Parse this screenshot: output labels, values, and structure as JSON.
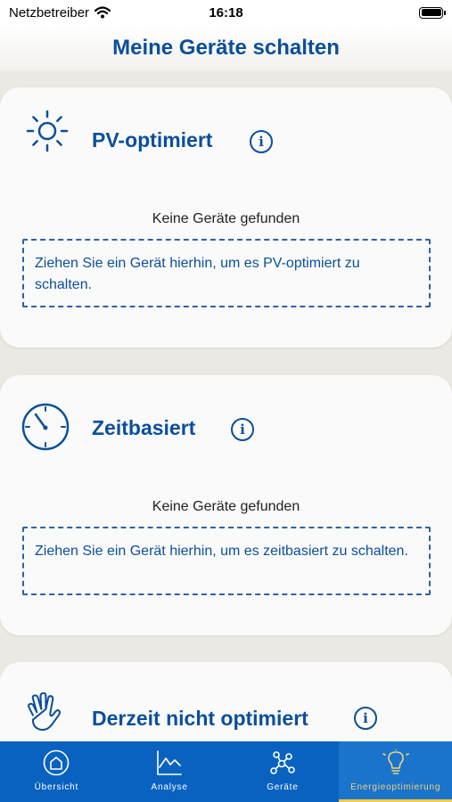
{
  "status_bar": {
    "carrier": "Netzbetreiber",
    "time": "16:18"
  },
  "header": {
    "title": "Meine Geräte schalten"
  },
  "cards": [
    {
      "title": "PV-optimiert",
      "icon": "sun-icon",
      "empty_text": "Keine Geräte gefunden",
      "drop_hint": "Ziehen Sie ein Gerät hierhin, um es PV-optimiert zu schalten."
    },
    {
      "title": "Zeitbasiert",
      "icon": "clock-icon",
      "empty_text": "Keine Geräte gefunden",
      "drop_hint": "Ziehen Sie ein Gerät hierhin, um es zeitbasiert zu schalten."
    },
    {
      "title": "Derzeit nicht optimiert",
      "icon": "hand-icon"
    }
  ],
  "info_glyph": "i",
  "tabs": [
    {
      "label": "Übersicht",
      "icon": "home-icon",
      "active": false
    },
    {
      "label": "Analyse",
      "icon": "chart-icon",
      "active": false
    },
    {
      "label": "Geräte",
      "icon": "network-icon",
      "active": false
    },
    {
      "label": "Energieoptimierung",
      "icon": "lightbulb-icon",
      "active": true
    }
  ],
  "colors": {
    "accent": "#0b4f9a",
    "tab_bar": "#0a62c0",
    "active_tab_highlight": "#f2c94c",
    "background": "#ebe9e4"
  }
}
